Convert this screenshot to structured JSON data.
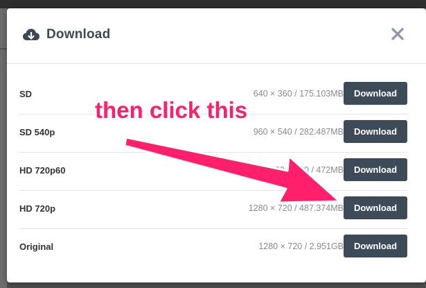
{
  "modal": {
    "title": "Download",
    "close_icon": "close-icon",
    "title_icon": "cloud-download-icon"
  },
  "rows": [
    {
      "label": "SD",
      "meta": "640 × 360 / 175.103MB",
      "button": "Download"
    },
    {
      "label": "SD 540p",
      "meta": "960 × 540 / 282.487MB",
      "button": "Download"
    },
    {
      "label": "HD 720p60",
      "meta": "1280 × 720 / 472MB",
      "button": "Download"
    },
    {
      "label": "HD 720p",
      "meta": "1280 × 720 / 487.374MB",
      "button": "Download"
    },
    {
      "label": "Original",
      "meta": "1280 × 720 / 2.951GB",
      "button": "Download"
    }
  ],
  "annotation": {
    "text": "then click this",
    "color": "#ff1f6b"
  },
  "colors": {
    "button_bg": "#3d4a57",
    "title": "#3b4856"
  }
}
